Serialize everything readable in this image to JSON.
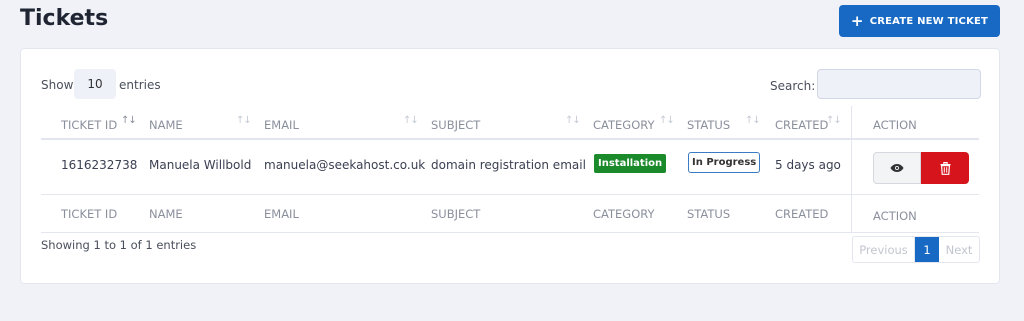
{
  "header": {
    "title": "Tickets",
    "create_button_label": "CREATE NEW TICKET",
    "create_button_icon": "+"
  },
  "controls": {
    "show_label": "Show",
    "entries_value": "10",
    "entries_label": "entries",
    "search_label": "Search:",
    "search_value": ""
  },
  "table": {
    "columns": [
      "TICKET ID",
      "NAME",
      "EMAIL",
      "SUBJECT",
      "CATEGORY",
      "STATUS",
      "CREATED",
      "ACTION"
    ],
    "rows": [
      {
        "ticket_id": "1616232738",
        "name": "Manuela Willbold",
        "email": "manuela@seekahost.co.uk",
        "subject": "domain registration email",
        "category": "Installation",
        "status": "In Progress",
        "created": "5 days ago"
      }
    ]
  },
  "footer": {
    "showing_text": "Showing 1 to 1 of 1 entries",
    "pagination": {
      "previous": "Previous",
      "current": "1",
      "next": "Next"
    }
  },
  "colors": {
    "primary": "#1769c4",
    "category_badge": "#1a8a2b",
    "delete": "#d6141c",
    "background": "#f1f2f7"
  }
}
